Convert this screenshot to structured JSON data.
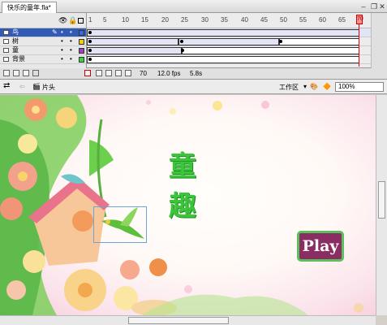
{
  "document": {
    "tab_title": "快乐的童年.fla*"
  },
  "timeline": {
    "ruler_labels": [
      "1",
      "5",
      "10",
      "15",
      "20",
      "25",
      "30",
      "35",
      "40",
      "45",
      "50",
      "55",
      "60",
      "65",
      "70"
    ],
    "playhead_frame": "70",
    "layers": [
      {
        "name": "鸟",
        "selected": true
      },
      {
        "name": "树",
        "selected": false
      },
      {
        "name": "童",
        "selected": false
      },
      {
        "name": "背景",
        "selected": false
      }
    ],
    "layer_colors": [
      "#3a66e0",
      "#f0d000",
      "#a040c0",
      "#40d040"
    ]
  },
  "status": {
    "current_frame": "70",
    "fps": "12.0 fps",
    "elapsed": "5.8s"
  },
  "editbar": {
    "scene": "片头",
    "workspace": "工作区",
    "zoom": "100%"
  },
  "stage": {
    "title": "童 趣",
    "play_label": "Play"
  }
}
